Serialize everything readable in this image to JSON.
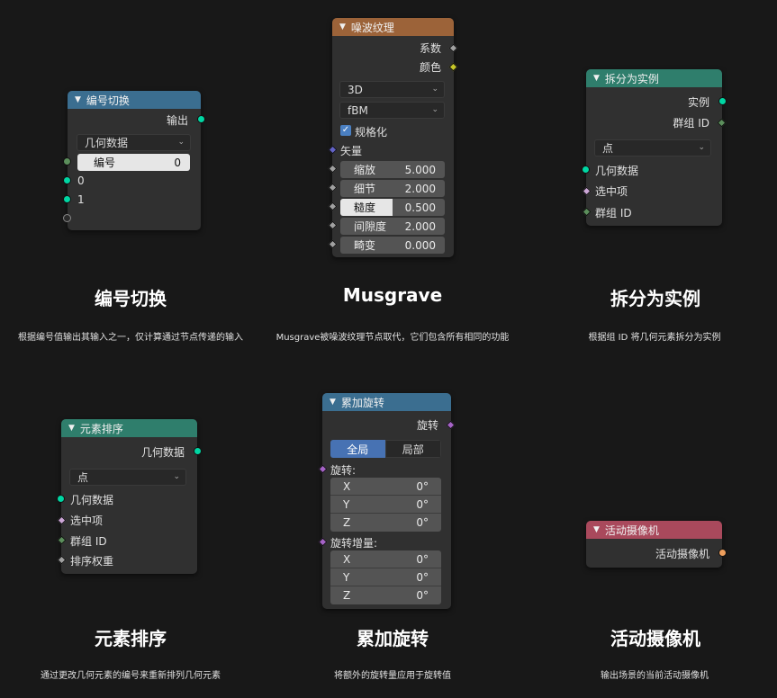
{
  "colors": {
    "background": "#181818",
    "node_body": "#303030",
    "header_blue": "#3b6e90",
    "header_orange": "#9c6339",
    "header_teal": "#2f7e6c",
    "header_red": "#a9495c",
    "socket_geometry": "#00d6a3",
    "socket_int": "#5c8f5c",
    "socket_float": "#a1a1a1",
    "socket_vector": "#6363c7",
    "socket_color": "#c7c729",
    "socket_rotation": "#a663c7",
    "socket_bool": "#cca6d6",
    "socket_object": "#ed9e5c"
  },
  "cards": [
    {
      "header": "编号切换",
      "output": "输出",
      "dropdown": "几何数据",
      "field": {
        "label": "编号",
        "value": "0"
      },
      "inputs": [
        "0",
        "1"
      ],
      "title": "编号切换",
      "desc": "根据编号值输出其输入之一，仅计算通过节点传递的输入"
    },
    {
      "header": "噪波纹理",
      "outputs": [
        "系数",
        "颜色"
      ],
      "dropdowns": [
        "3D",
        "fBM"
      ],
      "checkbox": "规格化",
      "vector": "矢量",
      "fields": [
        {
          "label": "缩放",
          "value": "5.000"
        },
        {
          "label": "细节",
          "value": "2.000"
        },
        {
          "label": "糙度",
          "value": "0.500",
          "fill": 0.5
        },
        {
          "label": "间隙度",
          "value": "2.000"
        },
        {
          "label": "畸变",
          "value": "0.000"
        }
      ],
      "title": "Musgrave",
      "desc": "Musgrave被噪波纹理节点取代，它们包含所有相同的功能"
    },
    {
      "header": "拆分为实例",
      "outputs": [
        "实例",
        "群组 ID"
      ],
      "dropdown": "点",
      "inputs": [
        "几何数据",
        "选中项",
        "群组 ID"
      ],
      "title": "拆分为实例",
      "desc": "根据组 ID 将几何元素拆分为实例"
    },
    {
      "header": "元素排序",
      "output": "几何数据",
      "dropdown": "点",
      "inputs": [
        "几何数据",
        "选中项",
        "群组 ID",
        "排序权重"
      ],
      "title": "元素排序",
      "desc": "通过更改几何元素的编号来重新排列几何元素"
    },
    {
      "header": "累加旋转",
      "output": "旋转",
      "toggle": [
        "全局",
        "局部"
      ],
      "group1": {
        "label": "旋转:",
        "rows": [
          {
            "k": "X",
            "v": "0°"
          },
          {
            "k": "Y",
            "v": "0°"
          },
          {
            "k": "Z",
            "v": "0°"
          }
        ]
      },
      "group2": {
        "label": "旋转增量:",
        "rows": [
          {
            "k": "X",
            "v": "0°"
          },
          {
            "k": "Y",
            "v": "0°"
          },
          {
            "k": "Z",
            "v": "0°"
          }
        ]
      },
      "title": "累加旋转",
      "desc": "将额外的旋转量应用于旋转值"
    },
    {
      "header": "活动摄像机",
      "output": "活动摄像机",
      "title": "活动摄像机",
      "desc": "输出场景的当前活动摄像机"
    }
  ],
  "icons": {
    "collapse": "chevron-down-icon",
    "dropdown": "chevron-down-icon",
    "check": "checkmark-icon"
  }
}
